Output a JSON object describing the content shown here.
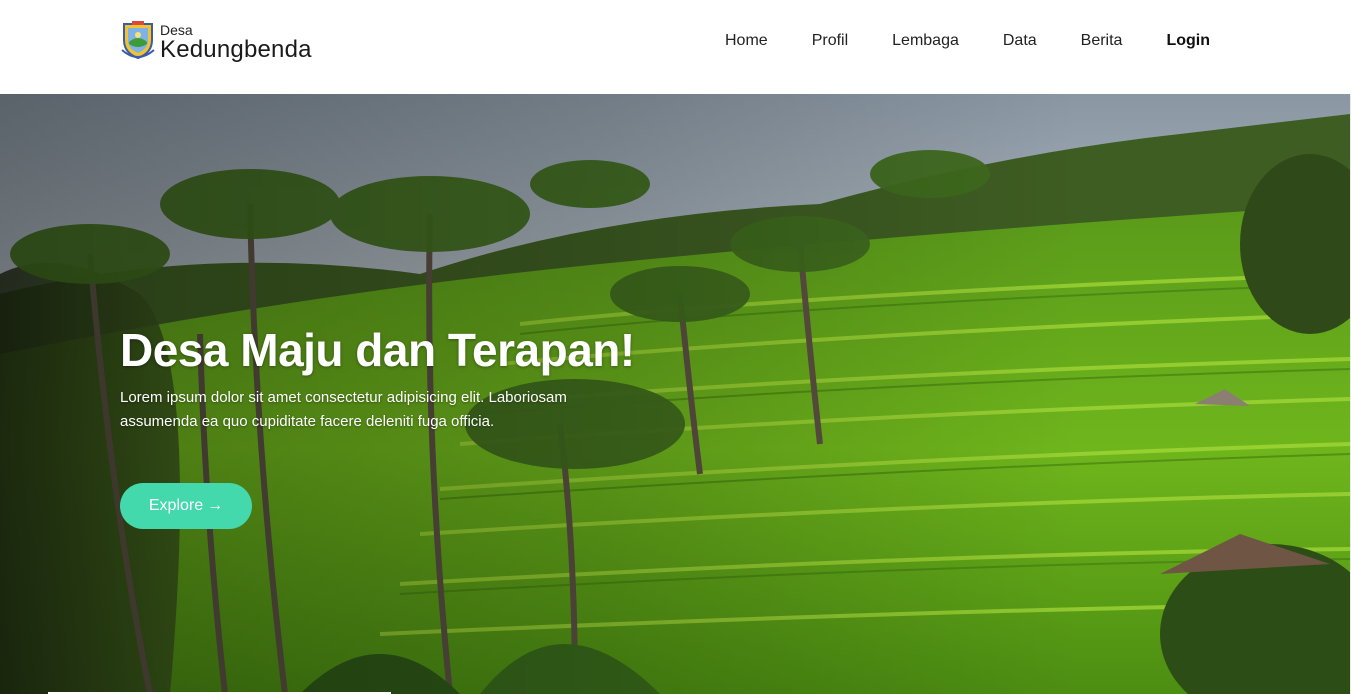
{
  "brand": {
    "small": "Desa",
    "name": "Kedungbenda",
    "logo_icon": "village-emblem-icon"
  },
  "nav": {
    "items": [
      {
        "label": "Home"
      },
      {
        "label": "Profil"
      },
      {
        "label": "Lembaga"
      },
      {
        "label": "Data"
      },
      {
        "label": "Berita"
      },
      {
        "label": "Login"
      }
    ]
  },
  "hero": {
    "title": "Desa Maju dan Terapan!",
    "description": "Lorem ipsum dolor sit amet consectetur adipisicing elit. Laboriosam assumenda ea quo cupiditate facere deleniti fuga officia.",
    "button_label": "Explore",
    "button_arrow": "→",
    "background_icon": "rice-terrace-palm-photo"
  },
  "colors": {
    "accent": "#43d9ad",
    "navbar_bg": "#ffffff",
    "hero_text": "#ffffff"
  }
}
